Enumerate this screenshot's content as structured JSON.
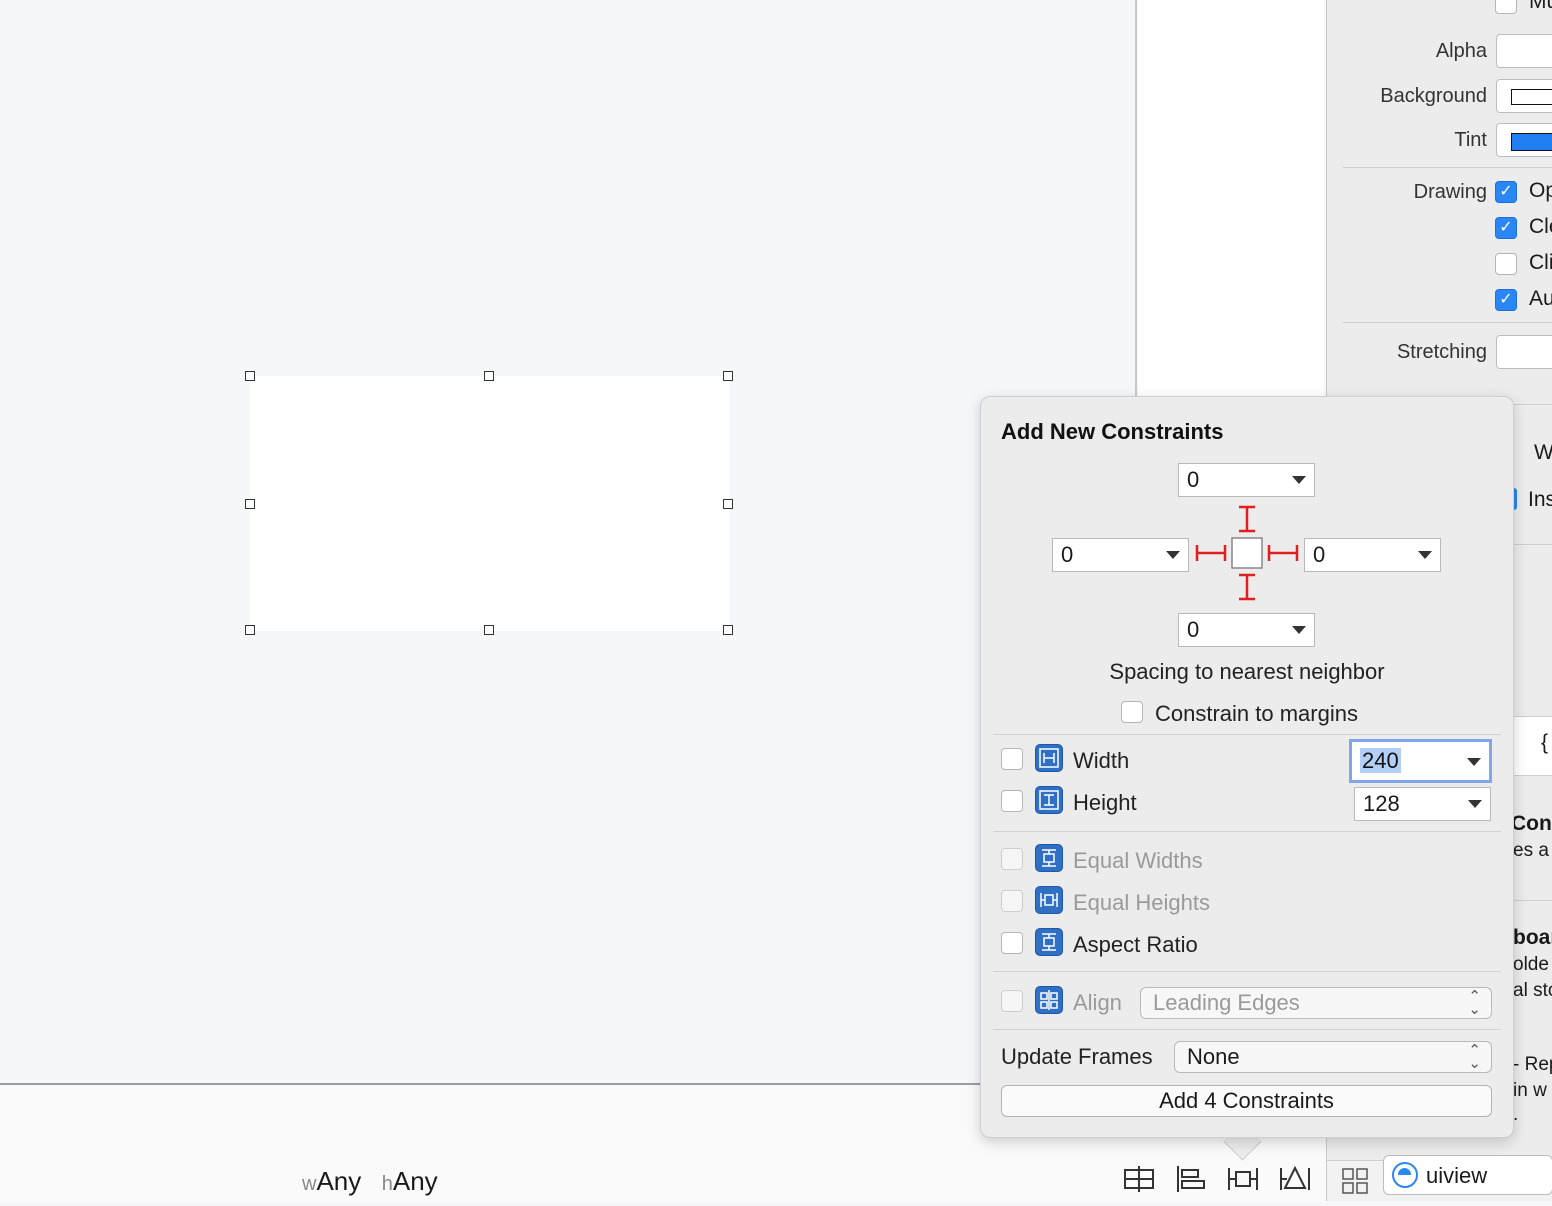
{
  "canvas": {
    "size_class": {
      "w_prefix": "w",
      "w_value": "Any",
      "h_prefix": "h",
      "h_value": "Any"
    }
  },
  "inspector": {
    "top_cut": "Mu",
    "alpha_label": "Alpha",
    "background_label": "Background",
    "tint_label": "Tint",
    "tint_color": "#1f7ff0",
    "drawing_label": "Drawing",
    "drawing_options": [
      {
        "text": "Op",
        "checked": true
      },
      {
        "text": "Cle",
        "checked": true
      },
      {
        "text": "Cli",
        "checked": false
      },
      {
        "text": "Au",
        "checked": true
      }
    ],
    "stretching_label": "Stretching",
    "cut_w": "W",
    "cut_ins": "Ins",
    "cut_brace": "{",
    "cut_cont": "Cont",
    "cut_es": "es a",
    "cut_boar": "boar",
    "cut_olde": "olde",
    "cut_alst": "al sto",
    "cut_rep": "- Rep",
    "cut_inw": "in w",
    "cut_dot": ".",
    "object_name": "uiview"
  },
  "popover": {
    "title": "Add New Constraints",
    "spacing": {
      "top": "0",
      "left": "0",
      "right": "0",
      "bottom": "0"
    },
    "spacing_caption": "Spacing to nearest neighbor",
    "constrain_margins": "Constrain to margins",
    "width_label": "Width",
    "width_value": "240",
    "height_label": "Height",
    "height_value": "128",
    "equal_widths": "Equal Widths",
    "equal_heights": "Equal Heights",
    "aspect_ratio": "Aspect Ratio",
    "align_label": "Align",
    "align_value": "Leading Edges",
    "update_frames_label": "Update Frames",
    "update_frames_value": "None",
    "add_button": "Add 4 Constraints"
  }
}
